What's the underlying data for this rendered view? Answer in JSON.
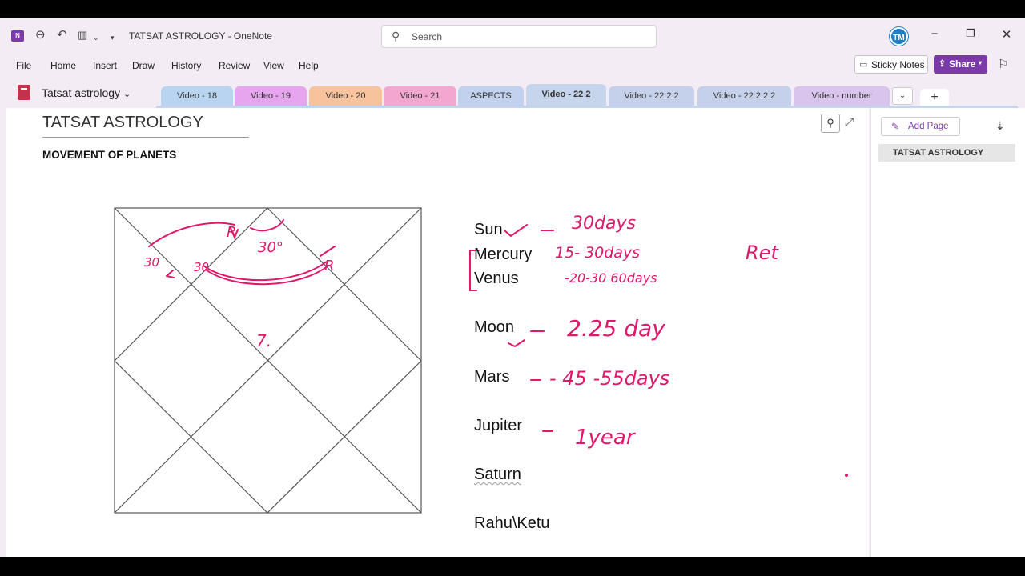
{
  "app": {
    "logo_text": "N",
    "window_title": "TATSAT ASTROLOGY  -  OneNote",
    "search_placeholder": "Search",
    "avatar_initials": "TM",
    "icons": {
      "back": "back-icon",
      "undo": "undo-icon",
      "pens": "pens-icon",
      "qat_more": "chevron-down-icon",
      "search": "search-icon",
      "minimize": "minimize-icon",
      "restore": "restore-icon",
      "close": "close-icon"
    }
  },
  "menu": {
    "items": [
      "File",
      "Home",
      "Insert",
      "Draw",
      "History",
      "Review",
      "View",
      "Help"
    ],
    "sticky_notes_label": "Sticky Notes",
    "share_label": "Share"
  },
  "notebook": {
    "name": "Tatsat astrology",
    "color": "#c4314b"
  },
  "sections": [
    {
      "label": "Video - 18",
      "color": "#b8d4f0"
    },
    {
      "label": "Video - 19",
      "color": "#e7a4ef"
    },
    {
      "label": "Video - 20",
      "color": "#f8c29c"
    },
    {
      "label": "Video - 21",
      "color": "#f2a6d0"
    },
    {
      "label": "ASPECTS",
      "color": "#c2d1ee"
    },
    {
      "label": "Video - 22 2",
      "color": "#c6d4ec",
      "active": true
    },
    {
      "label": "Video - 22 2 2",
      "color": "#c5d1ea"
    },
    {
      "label": "Video - 22 2 2 2",
      "color": "#c5d1ea"
    },
    {
      "label": "Video - number",
      "color": "#d9c4ee"
    }
  ],
  "page": {
    "title": "TATSAT ASTROLOGY",
    "heading": "MOVEMENT OF PLANETS",
    "planets": [
      "Sun",
      "Mercury",
      "Venus",
      "Moon",
      "Mars",
      "Jupiter",
      "Saturn",
      "Rahu\\Ketu"
    ],
    "handwriting": {
      "color": "#e0176b",
      "sun": "30days",
      "mercury": "15- 30days",
      "venus": "-20-30 60days",
      "ret": "Ret",
      "moon": "2.25 day",
      "mars": "- 45 -55days",
      "jupiter": "1year",
      "chart_house_number": "7.",
      "chart_deg_1": "30°",
      "chart_deg_2": "30",
      "chart_deg_3": "30",
      "chart_r1": "R",
      "chart_r2": "R"
    }
  },
  "right_pane": {
    "add_page_label": "Add Page",
    "pages": [
      "TATSAT ASTROLOGY"
    ],
    "accent": "#7b3aa8"
  }
}
